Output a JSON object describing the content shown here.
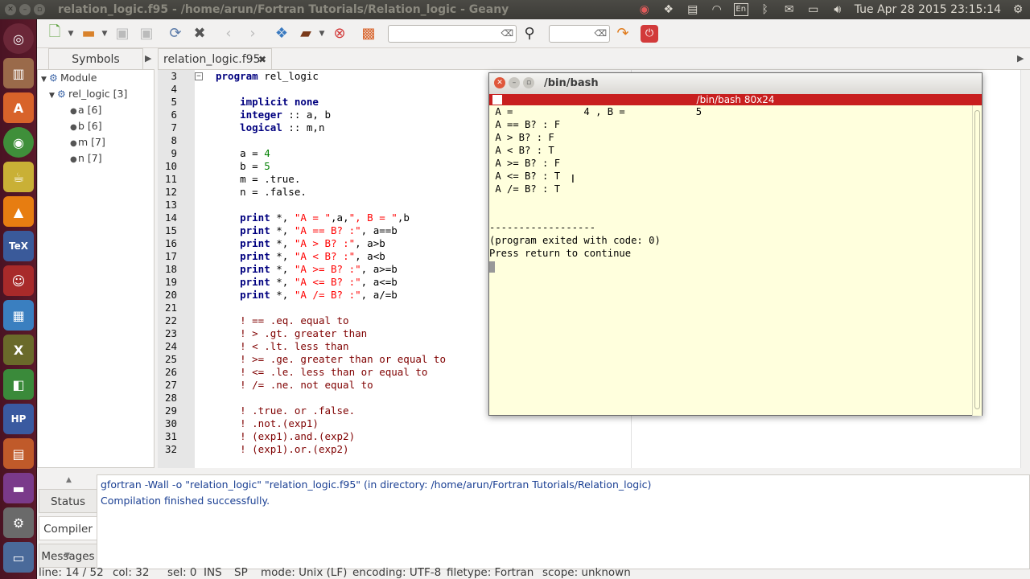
{
  "window_title": "relation_logic.f95 - /home/arun/Fortran Tutorials/Relation_logic - Geany",
  "top_panel": {
    "keyboard": "En",
    "datetime": "Tue Apr 28 2015 23:15:14"
  },
  "sidebar": {
    "tab_label": "Symbols",
    "tree": {
      "module": "Module",
      "program": "rel_logic [3]",
      "vars": [
        "a [6]",
        "b [6]",
        "m [7]",
        "n [7]"
      ]
    }
  },
  "editor": {
    "tab_label": "relation_logic.f95",
    "first_line_number": 3
  },
  "terminal": {
    "title": "/bin/bash",
    "xterm_title": "/bin/bash 80x24",
    "lines": [
      " A =            4 , B =            5",
      " A == B? : F",
      " A > B? : F",
      " A < B? : T",
      " A >= B? : F",
      " A <= B? : T",
      " A /= B? : T",
      "",
      "",
      "------------------",
      "(program exited with code: 0)",
      "Press return to continue"
    ]
  },
  "messages": {
    "tabs": [
      "Status",
      "Compiler",
      "Messages"
    ],
    "active_tab": "Compiler",
    "compiler_lines": [
      "gfortran -Wall -o \"relation_logic\" \"relation_logic.f95\" (in directory: /home/arun/Fortran Tutorials/Relation_logic)",
      "Compilation finished successfully."
    ]
  },
  "statusbar": {
    "line": "line: 14 / 52",
    "col": "col: 32",
    "sel": "sel: 0",
    "ins": "INS",
    "sp": "SP",
    "mode": "mode: Unix (LF)",
    "encoding": "encoding: UTF-8",
    "filetype": "filetype: Fortran",
    "scope": "scope: unknown"
  },
  "colors": {
    "keyword": "#00007f",
    "number": "#007f00",
    "string": "#ff0000",
    "comment": "#7f0000",
    "terminal_bg": "#ffffdd",
    "terminal_titlebar": "#c81f1f",
    "launcher": "#5a1a2a"
  }
}
